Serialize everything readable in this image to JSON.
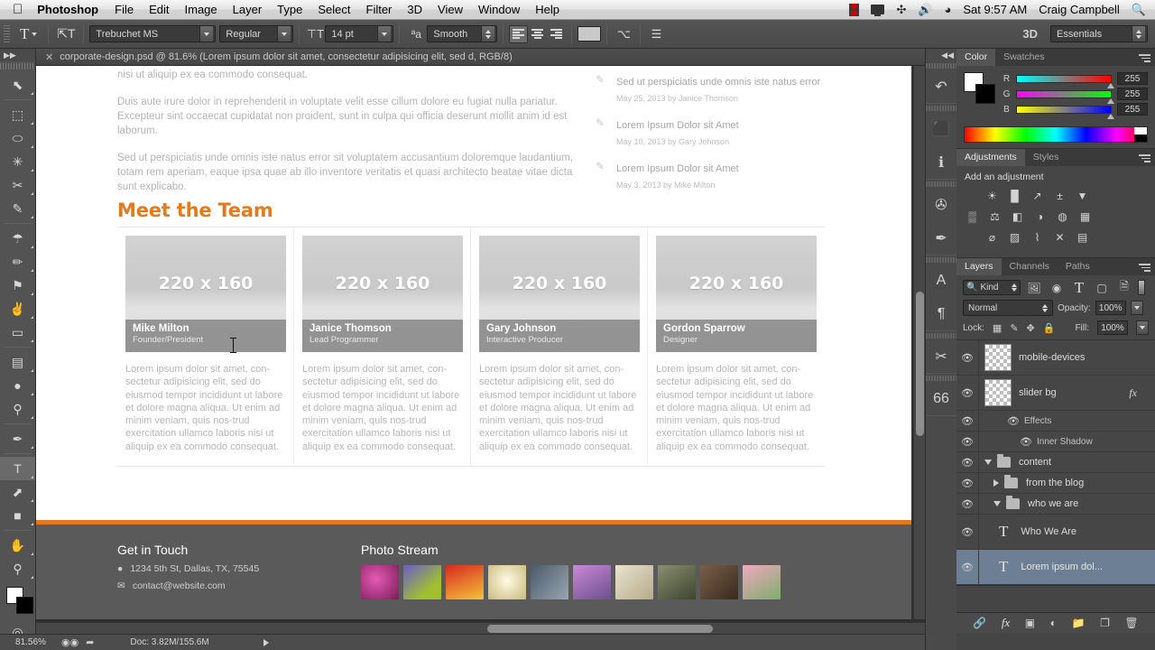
{
  "menubar": {
    "apple_icon": "apple-logo",
    "app_name": "Photoshop",
    "items": [
      "File",
      "Edit",
      "Image",
      "Layer",
      "Type",
      "Select",
      "Filter",
      "3D",
      "View",
      "Window",
      "Help"
    ],
    "status_icons": [
      "film-icon",
      "display-icon",
      "bluetooth-icon",
      "volume-icon",
      "wifi-icon"
    ],
    "time": "Sat 9:57 AM",
    "user": "Craig Campbell",
    "search_icon": "spotlight-search-icon"
  },
  "options_bar": {
    "tool_icon": "type-tool-icon",
    "orientation_icon": "toggle-text-orientation-icon",
    "font_family": "Trebuchet MS",
    "font_style": "Regular",
    "size_icon": "font-size-icon",
    "font_size": "14 pt",
    "antialias_icon": "anti-aliasing-icon",
    "antialias": "Smooth",
    "align_left_icon": "align-left-icon",
    "align_center_icon": "align-center-icon",
    "align_right_icon": "align-right-icon",
    "color_swatch": "#c9c9c9",
    "warp_icon": "create-warped-text-icon",
    "panels_icon": "toggle-character-paragraph-panels-icon",
    "three_d_label": "3D",
    "workspace": "Essentials"
  },
  "document_tab": {
    "close_icon": "close-tab-icon",
    "title": "corporate-design.psd @ 81.6% (Lorem ipsum dolor sit amet, consectetur adipisicing elit, sed d, RGB/8)"
  },
  "toolbar": {
    "collapse_icon": "collapse-panel-icon",
    "tools": [
      {
        "name": "move-tool",
        "glyph": "⬉",
        "selected": false
      },
      {
        "name": "rectangular-marquee-tool",
        "glyph": "⬚",
        "selected": false
      },
      {
        "name": "lasso-tool",
        "glyph": "⬭",
        "selected": false
      },
      {
        "name": "quick-selection-tool",
        "glyph": "✳",
        "selected": false
      },
      {
        "name": "crop-tool",
        "glyph": "✂",
        "selected": false
      },
      {
        "name": "eyedropper-tool",
        "glyph": "✎",
        "selected": false
      },
      {
        "name": "spot-healing-brush-tool",
        "glyph": "☂",
        "selected": false
      },
      {
        "name": "brush-tool",
        "glyph": "✏",
        "selected": false
      },
      {
        "name": "clone-stamp-tool",
        "glyph": "⚑",
        "selected": false
      },
      {
        "name": "history-brush-tool",
        "glyph": "✌",
        "selected": false
      },
      {
        "name": "eraser-tool",
        "glyph": "▭",
        "selected": false
      },
      {
        "name": "gradient-tool",
        "glyph": "▤",
        "selected": false
      },
      {
        "name": "blur-tool",
        "glyph": "●",
        "selected": false
      },
      {
        "name": "dodge-tool",
        "glyph": "⚲",
        "selected": false
      },
      {
        "name": "pen-tool",
        "glyph": "✒",
        "selected": false
      },
      {
        "name": "type-tool",
        "glyph": "T",
        "selected": true
      },
      {
        "name": "path-selection-tool",
        "glyph": "⬈",
        "selected": false
      },
      {
        "name": "rectangle-tool",
        "glyph": "■",
        "selected": false
      },
      {
        "name": "hand-tool",
        "glyph": "✋",
        "selected": false
      },
      {
        "name": "zoom-tool",
        "glyph": "⚲",
        "selected": false
      }
    ],
    "quick-mask-icon": "quick-mask-mode-icon",
    "swap_icon": "swap-foreground-background-icon",
    "foreground_color": "#ffffff",
    "background_color": "#000000"
  },
  "canvas": {
    "paragraphs": [
      "nisi ut aliquip ex ea commodo consequat.",
      "Duis aute irure dolor in reprehenderit in voluptate velit esse cillum dolore eu fugiat nulla pariatur. Excepteur sint occaecat cupidatat non proident, sunt in culpa qui officia deserunt mollit anim id est laborum.",
      "Sed ut perspiciatis unde omnis iste natus error sit voluptatem accusantium doloremque laudantium, totam rem aperiam, eaque ipsa quae ab illo inventore veritatis et quasi architecto beatae vitae dicta sunt explicabo."
    ],
    "blog_items": [
      {
        "icon": "pencil-icon",
        "title": "Sed ut perspiciatis unde omnis iste natus error",
        "meta": "May 25, 2013 by Janice Thomson"
      },
      {
        "icon": "pencil-icon",
        "title": "Lorem Ipsum Dolor sit Amet",
        "meta": "May 10, 2013 by Gary Johnson"
      },
      {
        "icon": "pencil-icon",
        "title": "Lorem Ipsum Dolor sit Amet",
        "meta": "May 3, 2013 by Mike Milton"
      }
    ],
    "team_heading": "Meet the Team",
    "team_heading_color": "#e07b1e",
    "placeholder_label": "220 x 160",
    "team": [
      {
        "name": "Mike Milton",
        "role": "Founder/President",
        "desc": "Lorem ipsum dolor sit amet, con-sectetur adipisicing elit, sed do eiusmod tempor incididunt ut labore et dolore magna aliqua. Ut enim ad minim veniam, quis nos-trud exercitation ullamco laboris nisi ut aliquip ex ea commodo consequat."
      },
      {
        "name": "Janice Thomson",
        "role": "Lead Programmer",
        "desc": "Lorem ipsum dolor sit amet, con-sectetur adipisicing elit, sed do eiusmod tempor incididunt ut labore et dolore magna aliqua. Ut enim ad minim veniam, quis nos-trud exercitation ullamco laboris nisi ut aliquip ex ea commodo consequat."
      },
      {
        "name": "Gary Johnson",
        "role": "Interactive Producer",
        "desc": "Lorem ipsum dolor sit amet, con-sectetur adipisicing elit, sed do eiusmod tempor incididunt ut labore et dolore magna aliqua. Ut enim ad minim veniam, quis nos-trud exercitation ullamco laboris nisi ut aliquip ex ea commodo consequat."
      },
      {
        "name": "Gordon Sparrow",
        "role": "Designer",
        "desc": "Lorem ipsum dolor sit amet, con-sectetur adipisicing elit, sed do eiusmod tempor incididunt ut labore et dolore magna aliqua. Ut enim ad minim veniam, quis nos-trud exercitation ullamco laboris nisi ut aliquip ex ea commodo consequat."
      }
    ],
    "footer": {
      "accent_color": "#e2791c",
      "get_in_touch_heading": "Get in Touch",
      "address_icon": "map-pin-icon",
      "address": "1234 5th St, Dallas, TX, 75545",
      "email_icon": "envelope-icon",
      "email": "contact@website.com",
      "photo_stream_heading": "Photo Stream",
      "photo_count": 10
    }
  },
  "status_bar": {
    "zoom": "81.56%",
    "camera_icon": "camera-raw-icon",
    "share_icon": "share-icon",
    "doc_info": "Doc: 3.82M/155.6M",
    "expand_icon": "expand-status-icon"
  },
  "icon_rail": {
    "collapse_icon": "collapse-dock-icon",
    "items": [
      {
        "name": "history-panel-icon",
        "glyph": "↶"
      },
      {
        "name": "3d-panel-icon",
        "glyph": "⬛"
      },
      {
        "name": "info-panel-icon",
        "glyph": "ℹ"
      },
      {
        "name": "brush-presets-panel-icon",
        "glyph": "✇"
      },
      {
        "name": "brush-panel-icon",
        "glyph": "✒"
      },
      {
        "name": "character-panel-icon",
        "glyph": "A"
      },
      {
        "name": "paragraph-panel-icon",
        "glyph": "¶"
      },
      {
        "name": "tool-presets-panel-icon",
        "glyph": "✂"
      },
      {
        "name": "kuler-panel-icon",
        "glyph": "66"
      }
    ]
  },
  "color_panel": {
    "tabs": [
      "Color",
      "Swatches"
    ],
    "active_tab": "Color",
    "menu_icon": "panel-menu-icon",
    "foreground_swatch": "#ffffff",
    "background_swatch": "#000000",
    "channels": [
      {
        "label": "R",
        "value": "255"
      },
      {
        "label": "G",
        "value": "255"
      },
      {
        "label": "B",
        "value": "255"
      }
    ]
  },
  "adjustments_panel": {
    "tabs": [
      "Adjustments",
      "Styles"
    ],
    "active_tab": "Adjustments",
    "menu_icon": "panel-menu-icon",
    "title": "Add an adjustment",
    "rows": [
      [
        {
          "name": "brightness-contrast-icon",
          "glyph": "☀"
        },
        {
          "name": "levels-icon",
          "glyph": "█"
        },
        {
          "name": "curves-icon",
          "glyph": "↗"
        },
        {
          "name": "exposure-icon",
          "glyph": "±"
        },
        {
          "name": "vibrance-icon",
          "glyph": "▼"
        }
      ],
      [
        {
          "name": "hue-saturation-icon",
          "glyph": "▒"
        },
        {
          "name": "color-balance-icon",
          "glyph": "⚖"
        },
        {
          "name": "black-white-icon",
          "glyph": "◧"
        },
        {
          "name": "photo-filter-icon",
          "glyph": "◑"
        },
        {
          "name": "channel-mixer-icon",
          "glyph": "◍"
        },
        {
          "name": "color-lookup-icon",
          "glyph": "▦"
        }
      ],
      [
        {
          "name": "invert-icon",
          "glyph": "⌀"
        },
        {
          "name": "posterize-icon",
          "glyph": "▨"
        },
        {
          "name": "threshold-icon",
          "glyph": "⌇"
        },
        {
          "name": "selective-color-icon",
          "glyph": "✕"
        },
        {
          "name": "gradient-map-icon",
          "glyph": "▤"
        }
      ]
    ]
  },
  "layers_panel": {
    "tabs": [
      "Layers",
      "Channels",
      "Paths"
    ],
    "active_tab": "Layers",
    "menu_icon": "panel-menu-icon",
    "filter_label": "Kind",
    "filter_search_icon": "search-icon",
    "filter_icons": [
      "pixel-layer-filter-icon",
      "adjustment-layer-filter-icon",
      "type-layer-filter-icon",
      "shape-layer-filter-icon",
      "smart-object-filter-icon"
    ],
    "filter_toggle_icon": "filter-toggle-icon",
    "blend_mode": "Normal",
    "opacity_label": "Opacity:",
    "opacity_value": "100%",
    "lock_label": "Lock:",
    "lock_icons": [
      "lock-transparent-pixels-icon",
      "lock-image-pixels-icon",
      "lock-position-icon",
      "lock-all-icon"
    ],
    "fill_label": "Fill:",
    "fill_value": "100%",
    "layers": [
      {
        "name": "mobile-devices",
        "type": "pixel",
        "visible": true,
        "selected": false,
        "fx": false,
        "indent": 0
      },
      {
        "name": "slider bg",
        "type": "pixel",
        "visible": true,
        "selected": false,
        "fx": true,
        "indent": 0
      },
      {
        "name": "Effects",
        "type": "effects",
        "visible": true,
        "selected": false,
        "fx": false,
        "indent": 1
      },
      {
        "name": "Inner Shadow",
        "type": "effect",
        "visible": true,
        "selected": false,
        "fx": false,
        "indent": 2
      },
      {
        "name": "content",
        "type": "group-open",
        "visible": true,
        "selected": false,
        "fx": false,
        "indent": 0
      },
      {
        "name": "from the blog",
        "type": "group-closed",
        "visible": true,
        "selected": false,
        "fx": false,
        "indent": 1
      },
      {
        "name": "who we are",
        "type": "group-open",
        "visible": true,
        "selected": false,
        "fx": false,
        "indent": 1
      },
      {
        "name": "Who We Are",
        "type": "text",
        "visible": true,
        "selected": false,
        "fx": false,
        "indent": 2
      },
      {
        "name": "Lorem ipsum dol...",
        "type": "text",
        "visible": true,
        "selected": true,
        "fx": false,
        "indent": 2
      }
    ],
    "footer_icons": [
      "link-layers-icon",
      "layer-style-icon",
      "layer-mask-icon",
      "new-adjustment-layer-icon",
      "new-group-icon",
      "new-layer-icon",
      "delete-layer-icon"
    ]
  }
}
